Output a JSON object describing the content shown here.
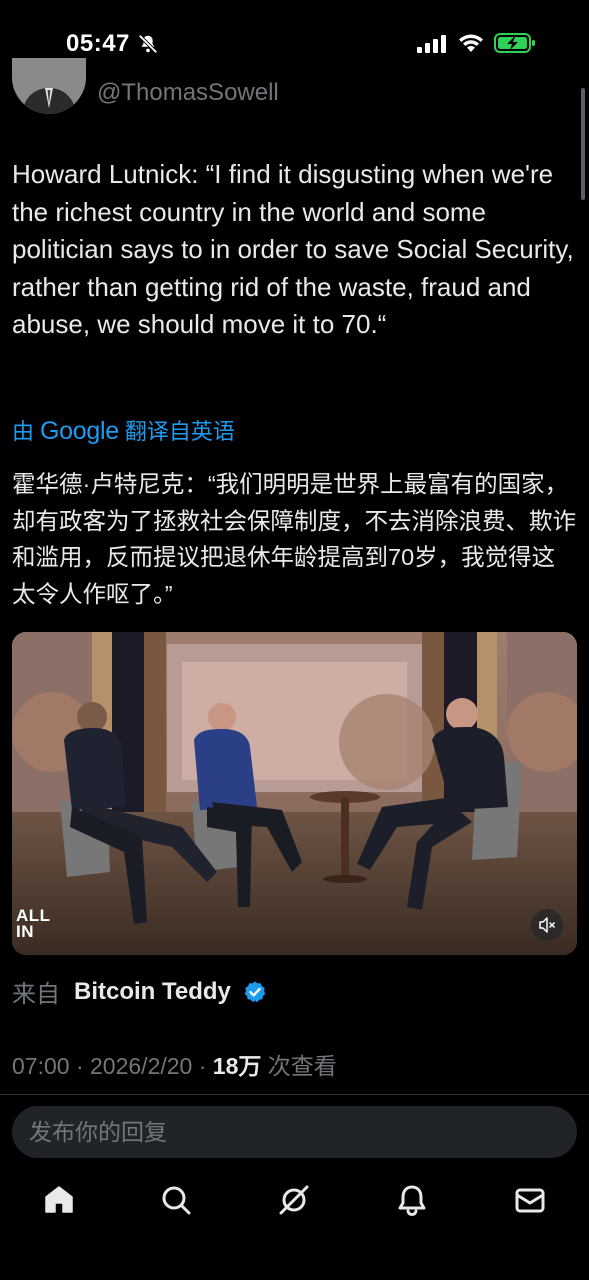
{
  "status_bar": {
    "time": "05:47",
    "icons": [
      "bell-off-icon",
      "signal-icon",
      "wifi-icon",
      "battery-charging-icon"
    ],
    "battery_color": "#30d158"
  },
  "author": {
    "handle": "@ThomasSowell"
  },
  "tweet": {
    "text": "Howard Lutnick: “I find it disgusting when we're the richest country in the world and some politician says to in order to save Social Security, rather than getting rid of the waste, fraud and abuse, we should move it to 70.“",
    "translation": {
      "prefix": "由",
      "provider": "Google",
      "suffix": "翻译自英语",
      "text": "霍华德·卢特尼克：“我们明明是世界上最富有的国家，却有政客为了拯救社会保障制度，不去消除浪费、欺诈和滥用，反而提议把退休年龄提高到70岁，我觉得这太令人作呕了。”"
    },
    "video": {
      "watermark_line1": "ALL",
      "watermark_line2": "IN",
      "mute_icon": "volume-muted-icon"
    },
    "source": {
      "prefix": "来自",
      "name": "Bitcoin Teddy",
      "verified_icon": "verified-badge-icon"
    },
    "meta": {
      "time": "07:00",
      "separator": " · ",
      "date": "2026/2/20",
      "views": "18万",
      "views_label": " 次查看"
    }
  },
  "reply": {
    "placeholder": "发布你的回复"
  },
  "tab_bar": {
    "items": [
      "home-icon",
      "search-icon",
      "grok-icon",
      "notifications-icon",
      "messages-icon"
    ]
  },
  "colors": {
    "background": "#000000",
    "text": "#e7e9ea",
    "secondary_text": "#71767b",
    "accent": "#1d9bf0",
    "input_bg": "#202327"
  }
}
